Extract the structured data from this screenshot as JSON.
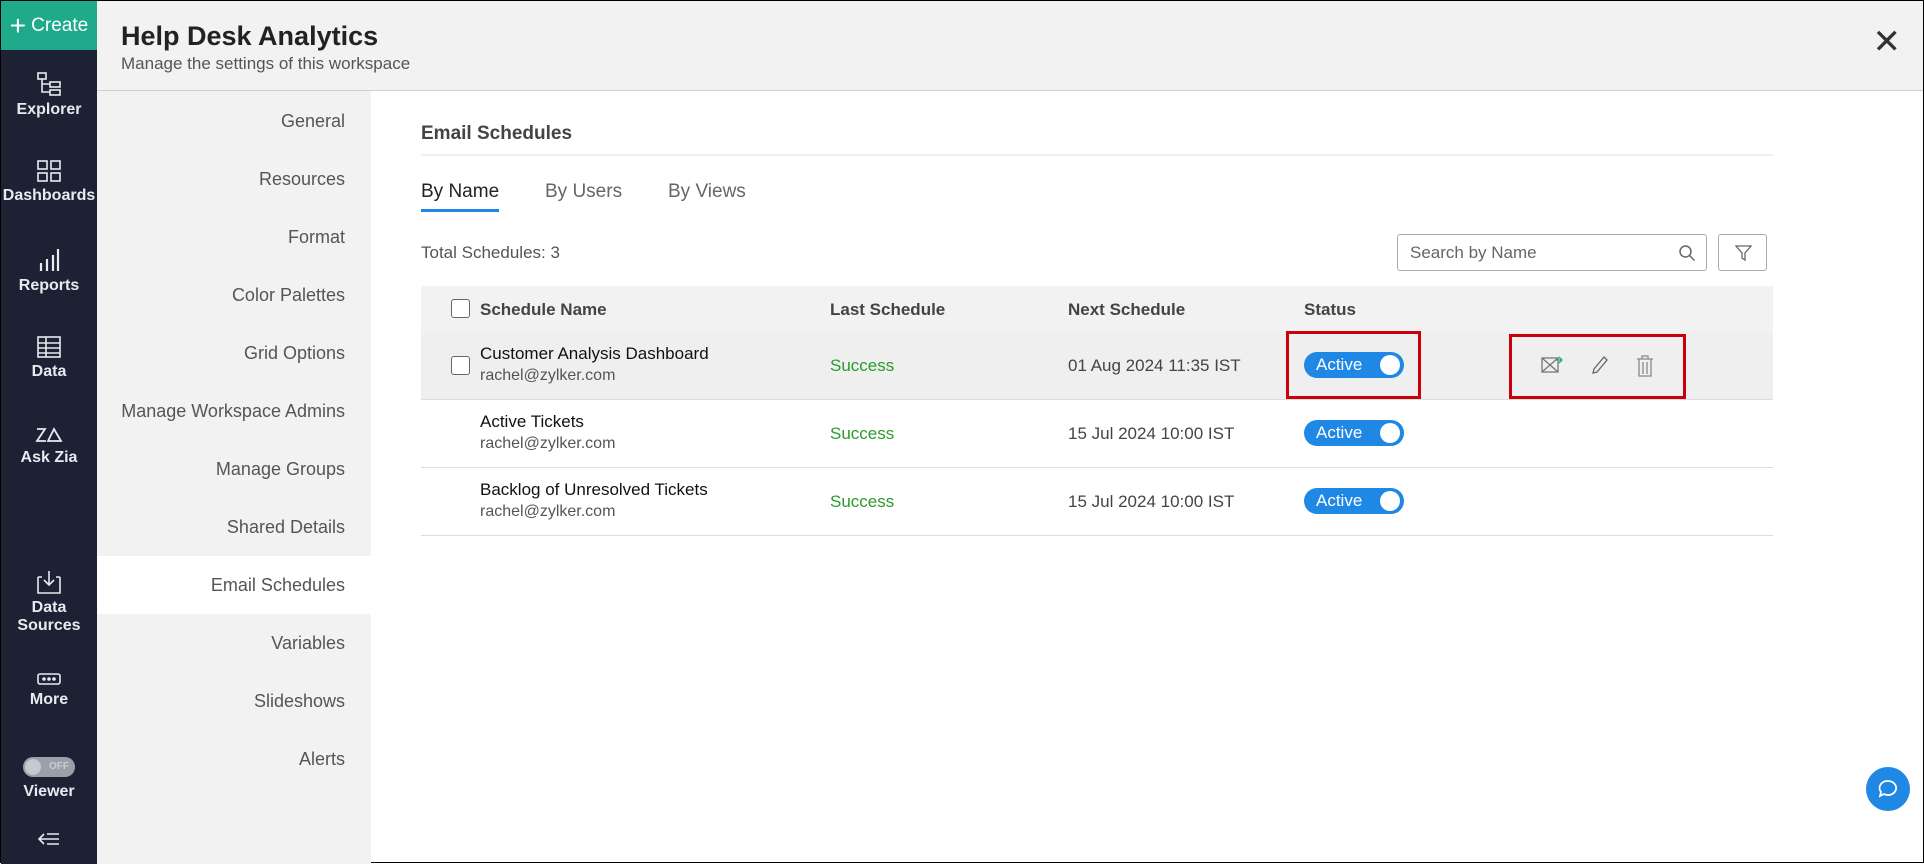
{
  "rail": {
    "create": "Create",
    "items": [
      {
        "label": "Explorer"
      },
      {
        "label": "Dashboards"
      },
      {
        "label": "Reports"
      },
      {
        "label": "Data"
      },
      {
        "label": "Ask Zia"
      },
      {
        "label": "Data Sources"
      },
      {
        "label": "More"
      }
    ],
    "viewer": {
      "label": "Viewer",
      "toggle": "OFF"
    }
  },
  "header": {
    "title": "Help Desk Analytics",
    "subtitle": "Manage the settings of this workspace"
  },
  "nav": [
    "General",
    "Resources",
    "Format",
    "Color Palettes",
    "Grid Options",
    "Manage Workspace Admins",
    "Manage Groups",
    "Shared Details",
    "Email Schedules",
    "Variables",
    "Slideshows",
    "Alerts"
  ],
  "main": {
    "section": "Email Schedules",
    "tabs": [
      "By Name",
      "By Users",
      "By Views"
    ],
    "total": "Total Schedules: 3",
    "search_placeholder": "Search by Name",
    "columns": [
      "Schedule Name",
      "Last Schedule",
      "Next Schedule",
      "Status"
    ],
    "rows": [
      {
        "name": "Customer Analysis Dashboard",
        "email": "rachel@zylker.com",
        "last": "Success",
        "next": "01 Aug 2024 11:35 IST",
        "status": "Active"
      },
      {
        "name": "Active Tickets",
        "email": "rachel@zylker.com",
        "last": "Success",
        "next": "15 Jul 2024 10:00 IST",
        "status": "Active"
      },
      {
        "name": "Backlog of Unresolved Tickets",
        "email": "rachel@zylker.com",
        "last": "Success",
        "next": "15 Jul 2024 10:00 IST",
        "status": "Active"
      }
    ]
  },
  "colors": {
    "accent": "#1f88e5",
    "create": "#1eaa8b",
    "rail": "#1c2134",
    "success": "#2a9a2a",
    "highlight": "#c8000a"
  }
}
